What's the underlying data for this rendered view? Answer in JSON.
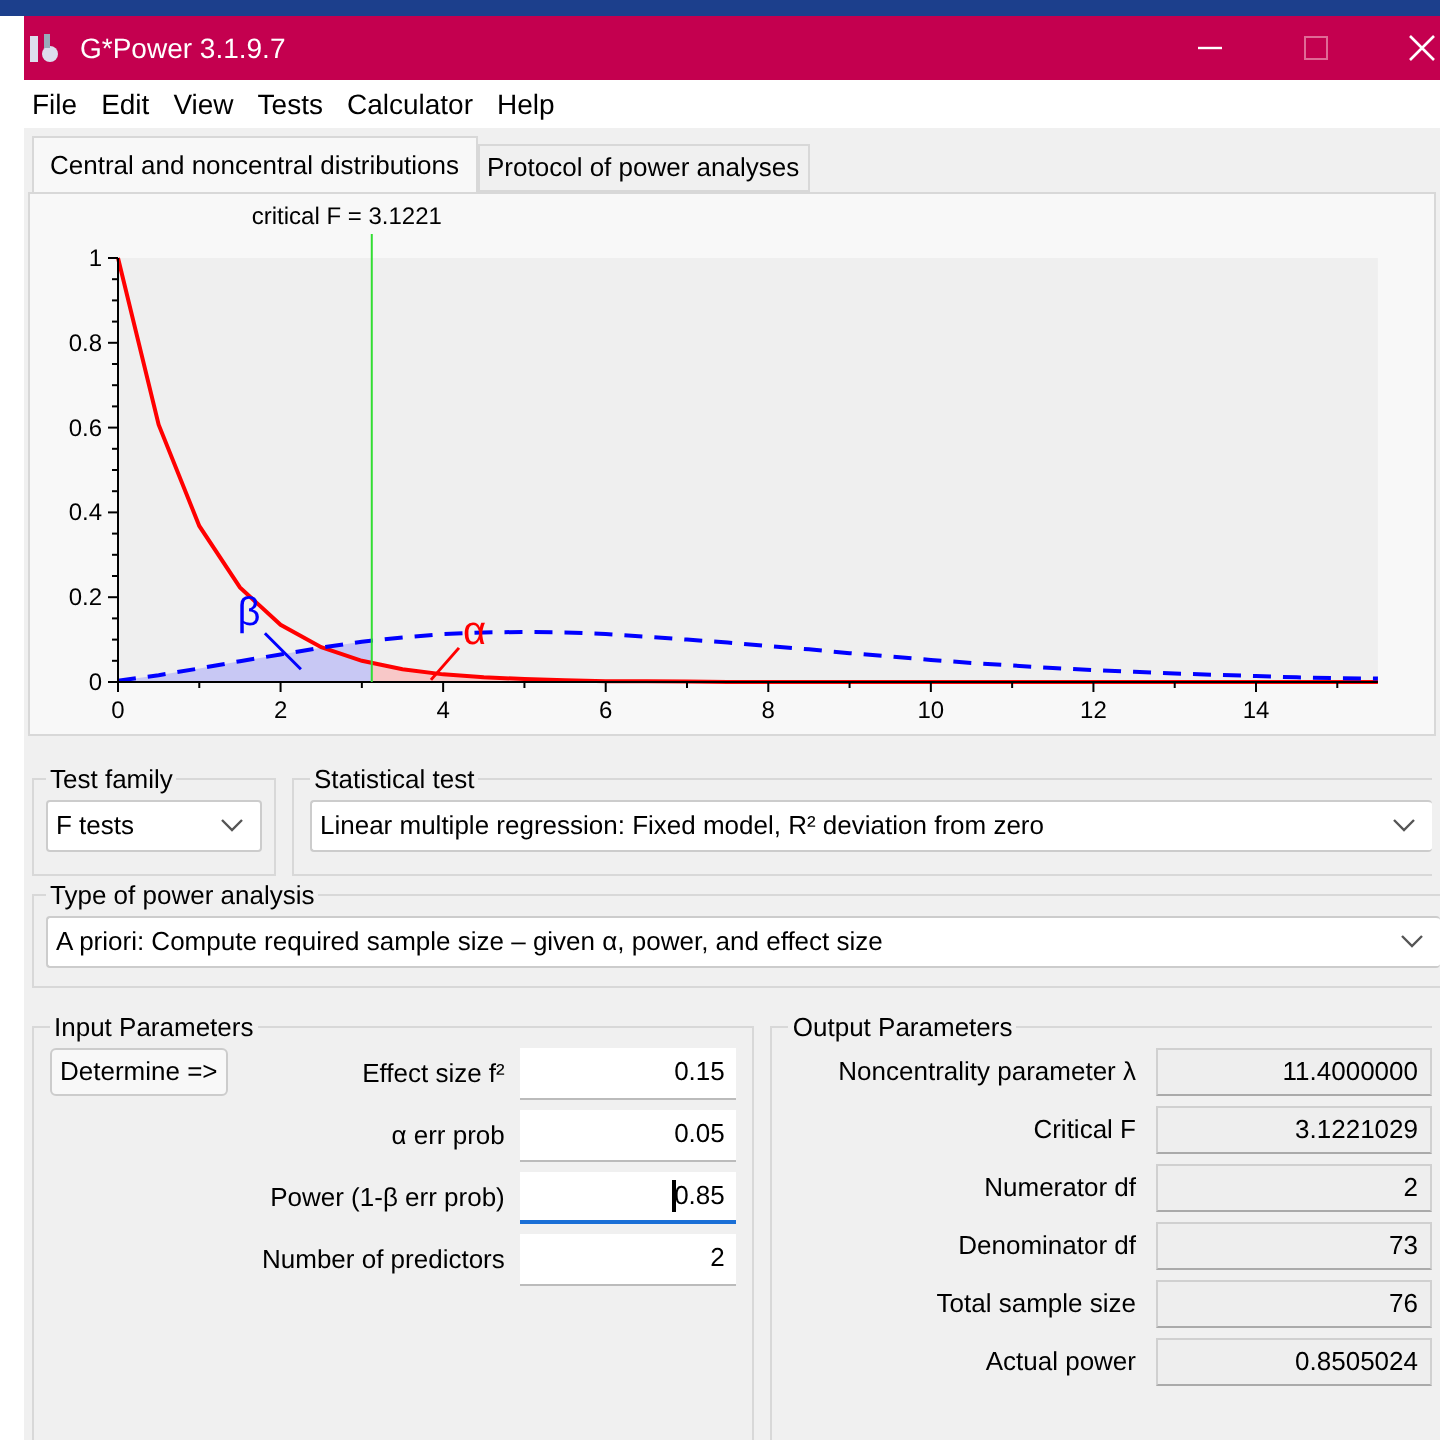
{
  "window": {
    "title": "G*Power 3.1.9.7"
  },
  "menu": [
    "File",
    "Edit",
    "View",
    "Tests",
    "Calculator",
    "Help"
  ],
  "tabs": [
    {
      "label": "Central and noncentral distributions",
      "selected": true
    },
    {
      "label": "Protocol of power analyses",
      "selected": false
    }
  ],
  "chart_data": {
    "type": "line",
    "x": [
      0,
      0.5,
      1,
      1.5,
      2,
      2.5,
      3,
      3.5,
      4,
      4.5,
      5,
      5.5,
      6,
      6.5,
      7,
      7.5,
      8,
      8.5,
      9,
      9.5,
      10,
      10.5,
      11,
      11.5,
      12,
      12.5,
      13,
      13.5,
      14,
      14.5,
      15,
      15.5
    ],
    "series": [
      {
        "color": "#ff0000",
        "line_style": "solid",
        "values": [
          1,
          0.607,
          0.368,
          0.223,
          0.135,
          0.082,
          0.05,
          0.03,
          0.018,
          0.011,
          0.007,
          0.004,
          0.002,
          0.002,
          0.001,
          0,
          0,
          0,
          0,
          0,
          0,
          0,
          0,
          0,
          0,
          0,
          0,
          0,
          0,
          0,
          0,
          0
        ]
      },
      {
        "color": "#0000ff",
        "line_style": "dashed",
        "values": [
          0.003,
          0.016,
          0.032,
          0.049,
          0.065,
          0.081,
          0.095,
          0.105,
          0.113,
          0.117,
          0.118,
          0.117,
          0.113,
          0.107,
          0.1,
          0.093,
          0.085,
          0.077,
          0.068,
          0.06,
          0.052,
          0.045,
          0.039,
          0.033,
          0.028,
          0.024,
          0.02,
          0.017,
          0.014,
          0.011,
          0.009,
          0.008
        ]
      }
    ],
    "xlim": [
      0,
      15.5
    ],
    "ylim": [
      0,
      1
    ],
    "xticks": [
      0,
      2,
      4,
      6,
      8,
      10,
      12,
      14
    ],
    "yticks": [
      0,
      {
        "value": 0.2,
        "label": "0.2"
      },
      {
        "value": 0.4,
        "label": "0.4"
      },
      {
        "value": 0.6,
        "label": "0.6"
      },
      {
        "value": 0.8,
        "label": "0.8"
      },
      1
    ],
    "ref_lines": [
      {
        "axis": "x",
        "value": 3.1221,
        "color": "#33dd33"
      }
    ]
  },
  "critical_value_label": "critical F = 3.1221",
  "beta_label": "β",
  "alpha_label": "α",
  "test_family": {
    "label": "Test family",
    "value": "F tests"
  },
  "statistical_test": {
    "label": "Statistical test",
    "value": "Linear multiple regression: Fixed model, R² deviation from zero"
  },
  "power_analysis": {
    "label": "Type of power analysis",
    "value": "A priori: Compute required sample size – given α, power, and effect size"
  },
  "input_parameters": {
    "title": "Input Parameters",
    "button": "Determine =>",
    "fields": [
      {
        "label": "Effect size f²",
        "value": "0.15",
        "focused": false
      },
      {
        "label": "α err prob",
        "value": "0.05",
        "focused": false
      },
      {
        "label": "Power (1-β err prob)",
        "value": "0.85",
        "focused": true
      },
      {
        "label": "Number of predictors",
        "value": "2",
        "focused": false
      }
    ]
  },
  "output_parameters": {
    "title": "Output Parameters",
    "fields": [
      {
        "label": "Noncentrality parameter λ",
        "value": "11.4000000"
      },
      {
        "label": "Critical F",
        "value": "3.1221029"
      },
      {
        "label": "Numerator df",
        "value": "2"
      },
      {
        "label": "Denominator df",
        "value": "73"
      },
      {
        "label": "Total sample size",
        "value": "76"
      },
      {
        "label": "Actual power",
        "value": "0.8505024"
      }
    ]
  }
}
